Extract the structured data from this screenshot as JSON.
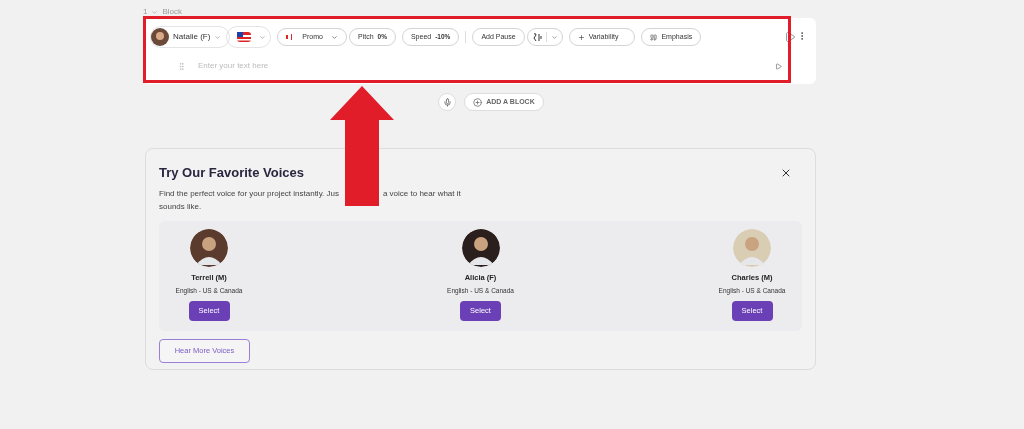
{
  "block": {
    "number": "1",
    "title": "Block",
    "voice": "Natalie (F)",
    "style": "Promo",
    "pitch_label": "Pitch",
    "pitch": "0%",
    "speed_label": "Speed",
    "speed": "-10%",
    "add_pause": "Add Pause",
    "variability": "Variability",
    "emphasis": "Emphasis",
    "text_placeholder": "Enter your text here"
  },
  "add_block": "ADD A BLOCK",
  "voices_panel": {
    "title": "Try Our Favorite Voices",
    "description_parts": [
      "Find the perfect voice for your project instantly. Jus",
      "a voice to hear what it",
      "sounds like."
    ],
    "voices": [
      {
        "name": "Terrell (M)",
        "language": "English - US & Canada",
        "button": "Select",
        "color": "#5a3b2e"
      },
      {
        "name": "Alicia (F)",
        "language": "English - US & Canada",
        "button": "Select",
        "color": "#2a1f1c"
      },
      {
        "name": "Charles (M)",
        "language": "English - US & Canada",
        "button": "Select",
        "color": "#d9cdb4"
      }
    ],
    "more_button": "Hear More Voices"
  }
}
